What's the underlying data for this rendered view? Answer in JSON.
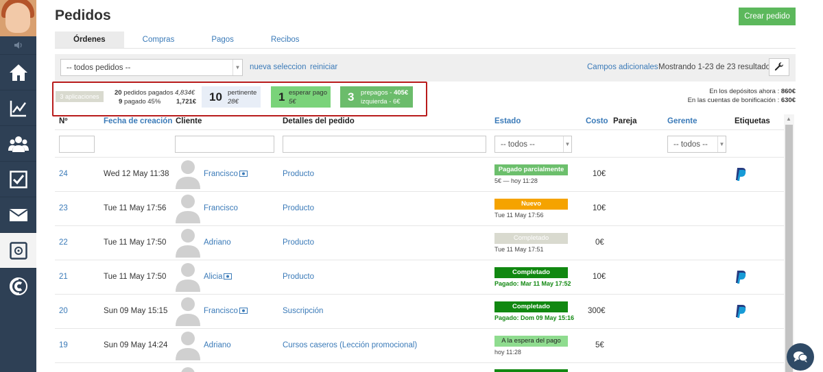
{
  "page": {
    "title": "Pedidos",
    "create_label": "Crear pedido"
  },
  "tabs": [
    {
      "label": "Órdenes",
      "active": true
    },
    {
      "label": "Compras"
    },
    {
      "label": "Pagos"
    },
    {
      "label": "Recibos"
    }
  ],
  "filterbar": {
    "select_value": "-- todos pedidos --",
    "new_selection": "nueva seleccion",
    "reset": "reiniciar",
    "extra_fields": "Campos adicionales",
    "showing": "Mostrando 1-23 de 23 resultados."
  },
  "stats": {
    "apps": "3 aplicaciones",
    "paid_count": "20",
    "paid_label": "pedidos pagados",
    "paid_amount": "4,834€",
    "paid_pct_count": "9",
    "paid_pct_label": "pagado 45%",
    "paid_pct_amount": "1,721€",
    "pertinent_num": "10",
    "pertinent_label": "pertinente",
    "pertinent_amount": "28€",
    "waiting_num": "1",
    "waiting_label": "esperar pago",
    "waiting_amount": "5€",
    "prepaid_num": "3",
    "prepaid_label": "prepagos - ",
    "prepaid_amount": "405€",
    "prepaid_left": "izquierda - 6€",
    "deposits_label": "En los depósitos ahora : ",
    "deposits_value": "860€",
    "bonus_label": "En las cuentas de bonificación : ",
    "bonus_value": "630€"
  },
  "table": {
    "headers": {
      "num": "Nº",
      "created": "Fecha de creación",
      "client": "Cliente",
      "details": "Detalles del pedido",
      "status": "Estado",
      "cost": "Costo",
      "pair": "Pareja",
      "manager": "Gerente",
      "tags": "Etiquetas"
    },
    "status_filter": "-- todos --",
    "manager_filter": "-- todos --",
    "rows": [
      {
        "num": "24",
        "date": "Wed 12 May 11:38",
        "client": "Francisco",
        "details": "Producto",
        "status": "Pagado parcialmente",
        "status_sub": "5€ — hoy 11:28",
        "cost": "10€"
      },
      {
        "num": "23",
        "date": "Tue 11 May 17:56",
        "client": "Francisco",
        "details": "Producto",
        "status": "Nuevo",
        "status_sub": "Tue 11 May 17:56",
        "cost": "10€"
      },
      {
        "num": "22",
        "date": "Tue 11 May 17:50",
        "client": "Adriano",
        "details": "Producto",
        "status": "Completado",
        "status_sub": "Tue 11 May 17:51",
        "cost": "0€"
      },
      {
        "num": "21",
        "date": "Tue 11 May 17:50",
        "client": "Alicia",
        "details": "Producto",
        "status": "Completado",
        "status_sub": "Pagado: Mar 11 May 17:52",
        "cost": "10€"
      },
      {
        "num": "20",
        "date": "Sun 09 May 15:15",
        "client": "Francisco",
        "details": "Suscripción",
        "status": "Completado",
        "status_sub": "Pagado: Dom 09 May 15:16",
        "cost": "300€"
      },
      {
        "num": "19",
        "date": "Sun 09 May 14:24",
        "client": "Adriano",
        "details": "Cursos caseros (Lección promocional)",
        "status": "A la espera del pago",
        "status_sub": "hoy 11:28",
        "cost": "5€"
      }
    ]
  },
  "colors": {
    "sidebar": "#2e4055",
    "accent": "#3a7ab8",
    "partial": "#6cbf6c",
    "new": "#f5a300",
    "completed_grey": "#d9dacf",
    "completed_green": "#118811",
    "waiting": "#8fdc8f",
    "highlight": "#b81a1a"
  }
}
